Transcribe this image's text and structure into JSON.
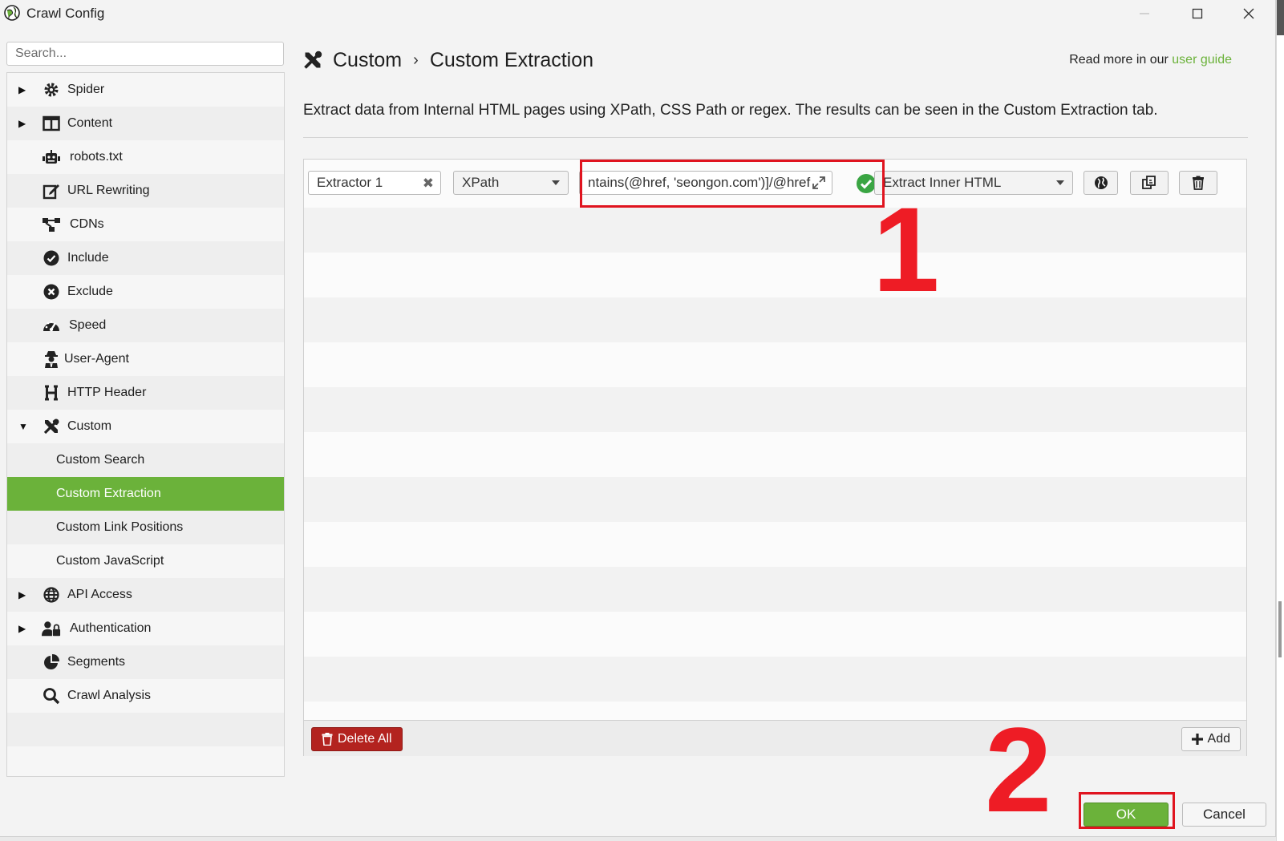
{
  "window": {
    "title": "Crawl Config"
  },
  "sidebar": {
    "search_placeholder": "Search...",
    "items": [
      {
        "label": "Spider",
        "icon": "gear-icon",
        "arrow": "▶"
      },
      {
        "label": "Content",
        "icon": "columns-icon",
        "arrow": "▶"
      },
      {
        "label": "robots.txt",
        "icon": "robot-icon"
      },
      {
        "label": "URL Rewriting",
        "icon": "edit-icon"
      },
      {
        "label": "CDNs",
        "icon": "network-icon"
      },
      {
        "label": "Include",
        "icon": "check-circle-icon"
      },
      {
        "label": "Exclude",
        "icon": "x-circle-icon"
      },
      {
        "label": "Speed",
        "icon": "speedometer-icon"
      },
      {
        "label": "User-Agent",
        "icon": "user-secret-icon"
      },
      {
        "label": "HTTP Header",
        "icon": "h-icon"
      },
      {
        "label": "Custom",
        "icon": "tools-icon",
        "arrow": "▼"
      },
      {
        "label": "Custom Search"
      },
      {
        "label": "Custom Extraction"
      },
      {
        "label": "Custom Link Positions"
      },
      {
        "label": "Custom JavaScript"
      },
      {
        "label": "API Access",
        "icon": "globe-icon",
        "arrow": "▶"
      },
      {
        "label": "Authentication",
        "icon": "user-lock-icon",
        "arrow": "▶"
      },
      {
        "label": "Segments",
        "icon": "pie-chart-icon"
      },
      {
        "label": "Crawl Analysis",
        "icon": "search-icon"
      }
    ]
  },
  "header": {
    "crumb_parent": "Custom",
    "crumb_sep": "›",
    "crumb_current": "Custom Extraction",
    "readmore_prefix": "Read more in our ",
    "readmore_link": "user guide",
    "description": "Extract data from Internal HTML pages using XPath, CSS Path or regex. The results can be seen in the Custom Extraction tab."
  },
  "extractor": {
    "name": "Extractor 1",
    "type": "XPath",
    "expression": "ntains(@href, 'seongon.com')]/@href",
    "mode": "Extract Inner HTML"
  },
  "footer": {
    "delete_all": "Delete All",
    "add": "Add"
  },
  "buttons": {
    "ok": "OK",
    "cancel": "Cancel"
  },
  "annotations": {
    "one": "1",
    "two": "2"
  },
  "colors": {
    "accent": "#6bb23a",
    "danger": "#b3231f",
    "annotation": "#ee1c25"
  }
}
